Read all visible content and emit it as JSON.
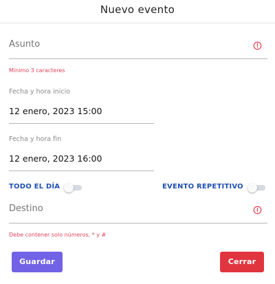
{
  "header": {
    "title": "Nuevo evento"
  },
  "subject": {
    "placeholder": "Asunto",
    "error": "Mínimo 3 caracteres"
  },
  "start": {
    "label": "Fecha y hora inicio",
    "value": "12 enero, 2023 15:00"
  },
  "end": {
    "label": "Fecha y hora fin",
    "value": "12 enero, 2023 16:00"
  },
  "toggles": {
    "all_day_label": "TODO EL DÍA",
    "all_day_on": false,
    "repeat_label": "EVENTO REPETITIVO",
    "repeat_on": false
  },
  "destination": {
    "placeholder": "Destino",
    "error": "Debe contener solo números, * y #"
  },
  "buttons": {
    "save_label": "Guardar",
    "close_label": "Cerrar"
  },
  "colors": {
    "primary": "#7262e5",
    "danger": "#e0353f",
    "error": "#e0445b",
    "toggle_label": "#1f4fb0"
  },
  "icons": {
    "error": "alert-circle-icon"
  }
}
